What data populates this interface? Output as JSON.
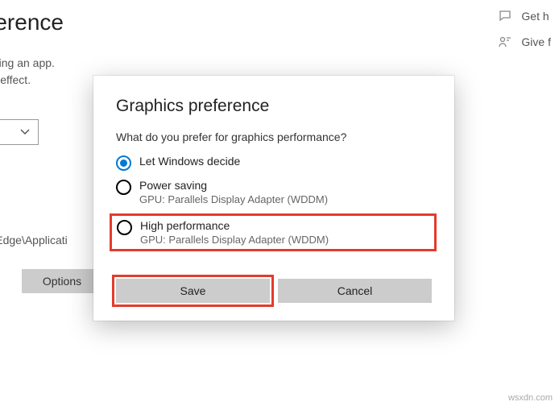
{
  "background": {
    "title": "eference",
    "subtext_line1": "e or battery life when using an app.",
    "subtext_line2": "or your changes to take effect.",
    "path_fragment": "osoft\\Edge\\Applicati",
    "options_label": "Options"
  },
  "help": {
    "get_help": "Get h",
    "give_feedback": "Give f"
  },
  "dialog": {
    "title": "Graphics preference",
    "question": "What do you prefer for graphics performance?",
    "options": [
      {
        "label": "Let Windows decide",
        "sub": ""
      },
      {
        "label": "Power saving",
        "sub": "GPU: Parallels Display Adapter (WDDM)"
      },
      {
        "label": "High performance",
        "sub": "GPU: Parallels Display Adapter (WDDM)"
      }
    ],
    "save_label": "Save",
    "cancel_label": "Cancel"
  },
  "watermark": "wsxdn.com"
}
